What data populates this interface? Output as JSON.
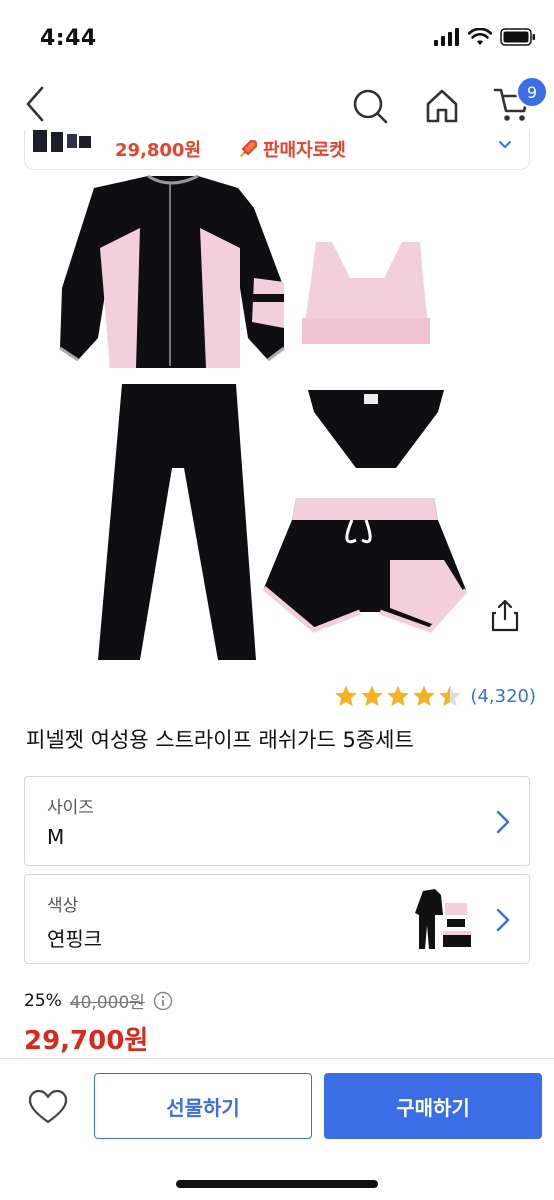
{
  "status_bar": {
    "time": "4:44"
  },
  "nav": {
    "cart_count": "9"
  },
  "mini_banner": {
    "price": "29,800원",
    "rocket_label": "판매자로켓"
  },
  "product": {
    "rating_stars": 4.5,
    "review_count": "(4,320)",
    "title": "피넬젯 여성용 스트라이프 래쉬가드 5종세트"
  },
  "options": [
    {
      "label": "사이즈",
      "value": "M"
    },
    {
      "label": "색상",
      "value": "연핑크"
    }
  ],
  "pricing": {
    "discount_rate": "25%",
    "original_price": "40,000원",
    "sale_price": "29,700원"
  },
  "bottom_bar": {
    "gift_label": "선물하기",
    "buy_label": "구매하기"
  },
  "colors": {
    "accent": "#3b6ee6",
    "price_red": "#d8291b",
    "star": "#f5b324",
    "pink": "#f3cfdc"
  }
}
